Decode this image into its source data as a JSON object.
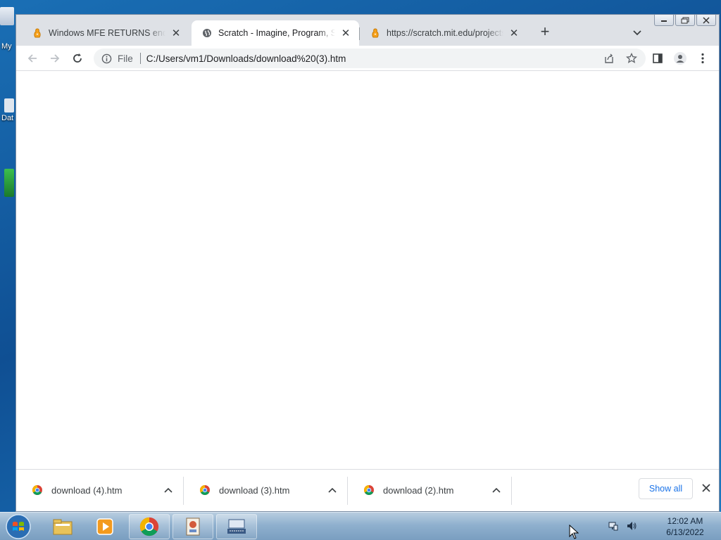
{
  "desktop": {
    "icons": [
      {
        "label": "My"
      },
      {
        "label": "Dat"
      },
      {
        "label": ""
      }
    ]
  },
  "browser": {
    "tabs": [
      {
        "title": "Windows MFE RETURNS ending",
        "favicon": "scratch-cat-icon",
        "active": false
      },
      {
        "title": "Scratch - Imagine, Program, Share",
        "favicon": "globe-icon",
        "active": true
      },
      {
        "title": "https://scratch.mit.edu/projects/",
        "favicon": "scratch-cat-icon",
        "active": false
      }
    ],
    "address_bar": {
      "scheme_label": "File",
      "url": "C:/Users/vm1/Downloads/download%20(3).htm"
    }
  },
  "downloads": {
    "items": [
      {
        "name": "download (4).htm"
      },
      {
        "name": "download (3).htm"
      },
      {
        "name": "download (2).htm"
      }
    ],
    "show_all_label": "Show all"
  },
  "taskbar": {
    "apps": [
      "windows-explorer-icon",
      "media-player-icon",
      "chrome-icon",
      "app-icon",
      "on-screen-keyboard-icon"
    ],
    "clock": {
      "time": "12:02 AM",
      "date": "6/13/2022"
    }
  },
  "colors": {
    "tabstrip": "#dee1e6",
    "accent": "#1a73e8",
    "desktop": "#1a6fb5"
  }
}
